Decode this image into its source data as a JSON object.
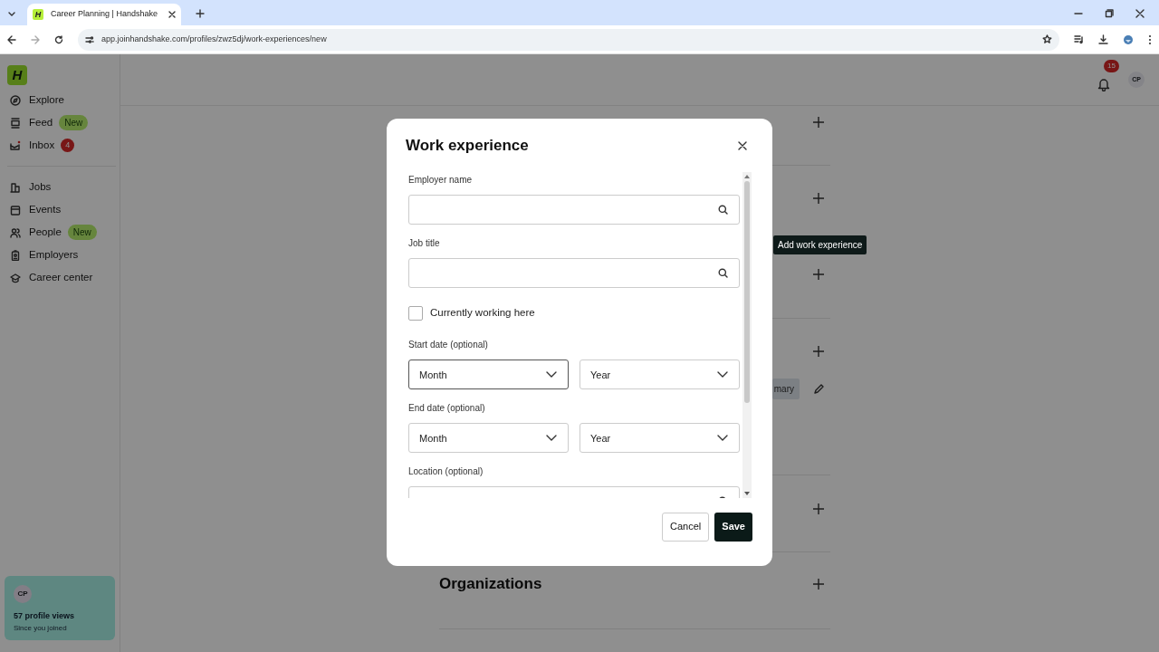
{
  "browser": {
    "tab": {
      "title": "Career Planning | Handshake",
      "favicon": "H"
    },
    "url": "app.joinhandshake.com/profiles/zwz5dj/work-experiences/new"
  },
  "logo": "H",
  "nav_groups": [
    [
      {
        "label": "Explore"
      },
      {
        "label": "Feed",
        "badge": {
          "kind": "new",
          "text": "New"
        }
      },
      {
        "label": "Inbox",
        "badge": {
          "kind": "count",
          "text": "4"
        }
      }
    ],
    [
      {
        "label": "Jobs"
      },
      {
        "label": "Events"
      },
      {
        "label": "People",
        "badge": {
          "kind": "new",
          "text": "New"
        }
      },
      {
        "label": "Employers"
      },
      {
        "label": "Career center"
      }
    ]
  ],
  "profile_card": {
    "avatar": "CP",
    "views": "57 profile views",
    "note": "Since you joined"
  },
  "header": {
    "notifications": "15",
    "avatar": "CP"
  },
  "content": {
    "chip": "mary",
    "section_title": "Organizations",
    "tooltip": "Add work experience"
  },
  "modal": {
    "title": "Work experience",
    "fields": [
      {
        "kind": "search",
        "label": "Employer name"
      },
      {
        "kind": "search",
        "label": "Job title"
      },
      {
        "kind": "checkbox",
        "label": "Currently working here",
        "checked": false
      },
      {
        "kind": "dates",
        "label": "Start date (optional)",
        "selects": [
          {
            "value": "Month",
            "focused": true
          },
          {
            "value": "Year",
            "focused": false
          }
        ]
      },
      {
        "kind": "dates",
        "label": "End date (optional)",
        "selects": [
          {
            "value": "Month",
            "focused": false
          },
          {
            "value": "Year",
            "focused": false
          }
        ]
      },
      {
        "kind": "search",
        "label": "Location (optional)"
      }
    ],
    "buttons": {
      "cancel": "Cancel",
      "save": "Save"
    }
  }
}
